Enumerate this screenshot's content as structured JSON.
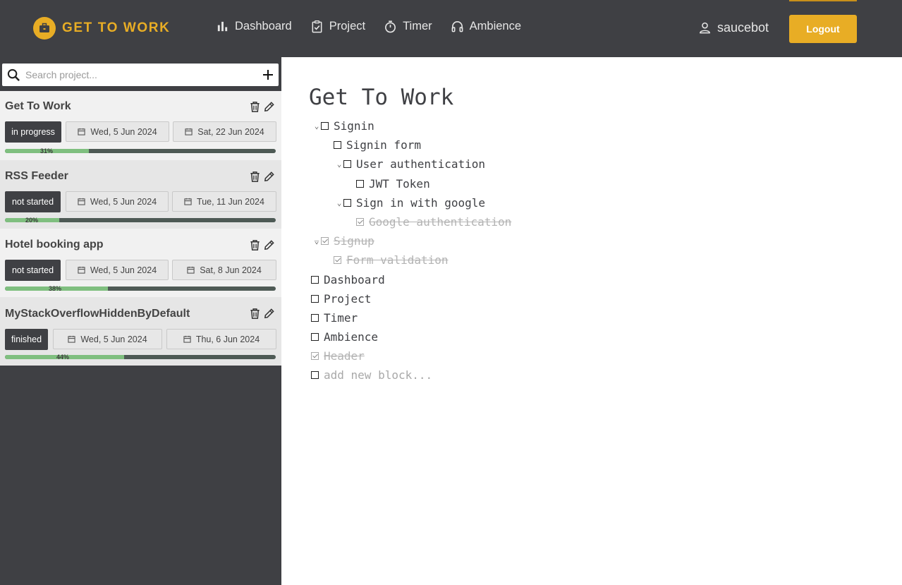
{
  "header": {
    "brand": "GET TO WORK",
    "nav": [
      {
        "label": "Dashboard",
        "icon": "bar-chart-icon"
      },
      {
        "label": "Project",
        "icon": "clipboard-check-icon"
      },
      {
        "label": "Timer",
        "icon": "stopwatch-icon"
      },
      {
        "label": "Ambience",
        "icon": "headphones-icon"
      }
    ],
    "username": "saucebot",
    "logout_label": "Logout"
  },
  "sidebar": {
    "search_placeholder": "Search project...",
    "projects": [
      {
        "name": "Get To Work",
        "status": "in progress",
        "start": "Wed, 5 Jun 2024",
        "end": "Sat, 22 Jun 2024",
        "progress_label": "31%",
        "progress": 0.31
      },
      {
        "name": "RSS Feeder",
        "status": "not started",
        "start": "Wed, 5 Jun 2024",
        "end": "Tue, 11 Jun 2024",
        "progress_label": "20%",
        "progress": 0.2
      },
      {
        "name": "Hotel booking app",
        "status": "not started",
        "start": "Wed, 5 Jun 2024",
        "end": "Sat, 8 Jun 2024",
        "progress_label": "38%",
        "progress": 0.38
      },
      {
        "name": "MyStackOverflowHiddenByDefault",
        "status": "finished",
        "start": "Wed, 5 Jun 2024",
        "end": "Thu, 6 Jun 2024",
        "progress_label": "44%",
        "progress": 0.44
      }
    ]
  },
  "main": {
    "title": "Get To Work",
    "blocks": [
      {
        "text": "Signin",
        "done": false,
        "collapsible": true
      },
      {
        "text": "Signin form",
        "done": false,
        "collapsible": false
      },
      {
        "text": "User authentication",
        "done": false,
        "collapsible": true
      },
      {
        "text": "JWT Token",
        "done": false,
        "collapsible": false
      },
      {
        "text": "Sign in with google",
        "done": false,
        "collapsible": true
      },
      {
        "text": "Google authentication",
        "done": true,
        "collapsible": false
      },
      {
        "text": "Signup",
        "done": true,
        "collapsible": true
      },
      {
        "text": "Form validation",
        "done": true,
        "collapsible": false
      },
      {
        "text": "Dashboard",
        "done": false,
        "collapsible": false
      },
      {
        "text": "Project",
        "done": false,
        "collapsible": false
      },
      {
        "text": "Timer",
        "done": false,
        "collapsible": false
      },
      {
        "text": "Ambience",
        "done": false,
        "collapsible": false
      },
      {
        "text": "Header",
        "done": true,
        "collapsible": false
      }
    ],
    "new_block_placeholder": "add new block..."
  },
  "colors": {
    "accent": "#e8ad25",
    "dark": "#3f4044",
    "progress": "#7fbf7f"
  }
}
